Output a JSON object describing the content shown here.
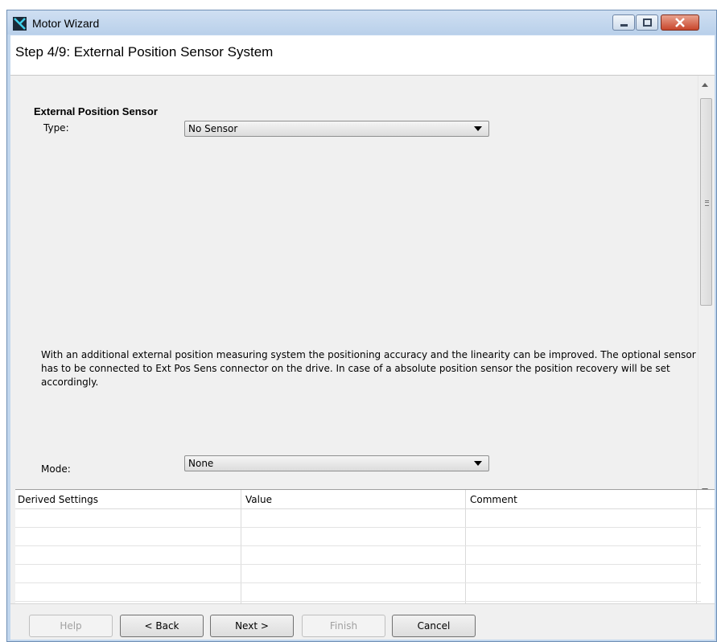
{
  "window": {
    "title": "Motor Wizard"
  },
  "header": {
    "step_title": "Step 4/9: External Position Sensor System"
  },
  "section": {
    "title": "External Position Sensor",
    "type_label": "Type:",
    "type_value": "No Sensor",
    "description": "With an additional external position measuring system the positioning accuracy and the linearity can be improved. The optional sensor has to be connected to Ext Pos Sens connector on the drive. In case of a absolute position sensor the position recovery will be set accordingly.",
    "mode_label": "Mode:",
    "mode_value": "None"
  },
  "table": {
    "columns": [
      "Derived Settings",
      "Value",
      "Comment"
    ],
    "rows": []
  },
  "footer": {
    "help": "Help",
    "back": "< Back",
    "next": "Next >",
    "finish": "Finish",
    "cancel": "Cancel"
  },
  "colors": {
    "title_bar": "#c2d7ee",
    "close_button": "#c8462c",
    "panel": "#f0f0f0"
  }
}
